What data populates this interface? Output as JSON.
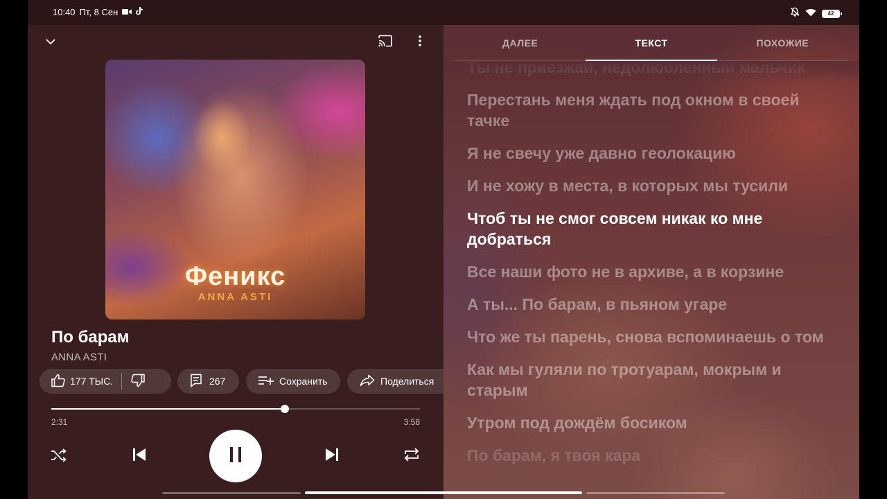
{
  "status": {
    "time": "10:40",
    "date": "Пт, 8 Сен",
    "battery": "42",
    "icons": [
      "video-icon",
      "tiktok-icon",
      "bell-off-icon",
      "wifi-icon",
      "battery-icon"
    ]
  },
  "player": {
    "album_title": "Феникс",
    "album_artist": "ANNA ASTI",
    "song_title": "По барам",
    "artist": "ANNA ASTI",
    "likes": "177 ТЫС.",
    "comments": "267",
    "save_label": "Сохранить",
    "share_label": "Поделиться",
    "elapsed": "2:31",
    "duration": "3:58",
    "progress": 0.634
  },
  "tabs": [
    {
      "label": "ДАЛЕЕ",
      "active": false
    },
    {
      "label": "ТЕКСТ",
      "active": true
    },
    {
      "label": "ПОХОЖИЕ",
      "active": false
    }
  ],
  "lyrics": [
    "Ты не приезжай, недолюбленный мальчик",
    "Перестань меня ждать под окном в своей тачке",
    "Я не свечу уже давно геолокацию",
    "И не хожу в места, в которых мы тусили",
    "Чтоб ты не смог совсем никак ко мне добраться",
    "Все наши фото не в архиве, а в корзине",
    "А ты... По барам, в пьяном угаре",
    "Что же ты парень, снова вспоминаешь о том",
    "Как мы гуляли по тротуарам, мокрым и старым",
    "Утром под дождём босиком",
    "По барам, я твоя кара"
  ],
  "current_lyric_index": 4,
  "colors": {
    "background": "#3a1e1f",
    "accent": "#ffffff"
  }
}
